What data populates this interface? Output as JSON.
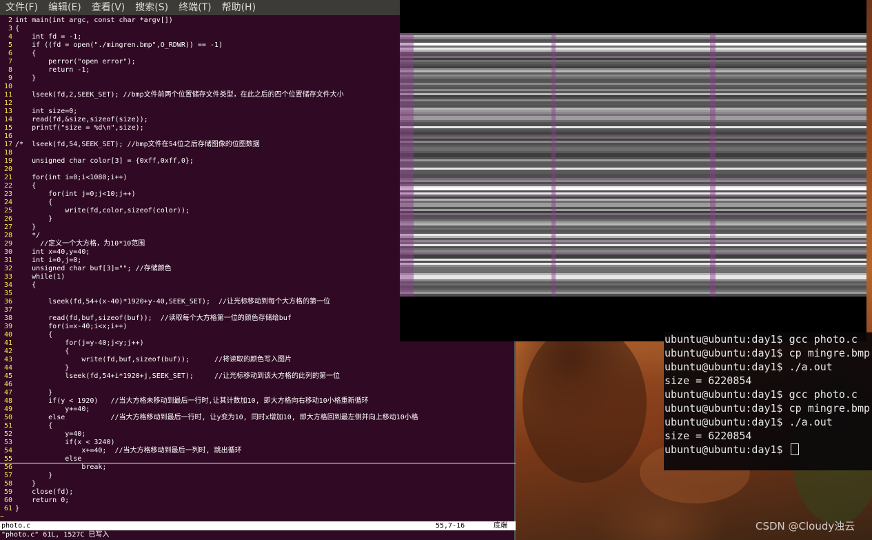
{
  "menubar": {
    "items": [
      "文件(F)",
      "编辑(E)",
      "查看(V)",
      "搜索(S)",
      "终端(T)",
      "帮助(H)"
    ]
  },
  "editor": {
    "lines": [
      {
        "n": "2",
        "t": "int main(int argc, const char *argv[])"
      },
      {
        "n": "3",
        "t": "{"
      },
      {
        "n": "4",
        "t": "    int fd = -1;"
      },
      {
        "n": "5",
        "t": "    if ((fd = open(\"./mingren.bmp\",O_RDWR)) == -1)"
      },
      {
        "n": "6",
        "t": "    {"
      },
      {
        "n": "7",
        "t": "        perror(\"open error\");"
      },
      {
        "n": "8",
        "t": "        return -1;"
      },
      {
        "n": "9",
        "t": "    }"
      },
      {
        "n": "10",
        "t": ""
      },
      {
        "n": "11",
        "t": "    lseek(fd,2,SEEK_SET); //bmp文件前两个位置储存文件类型，在此之后的四个位置储存文件大小"
      },
      {
        "n": "12",
        "t": ""
      },
      {
        "n": "13",
        "t": "    int size=0;"
      },
      {
        "n": "14",
        "t": "    read(fd,&size,sizeof(size));"
      },
      {
        "n": "15",
        "t": "    printf(\"size = %d\\n\",size);"
      },
      {
        "n": "16",
        "t": ""
      },
      {
        "n": "17",
        "t": "/*  lseek(fd,54,SEEK_SET); //bmp文件在54位之后存储图像的位图数据"
      },
      {
        "n": "18",
        "t": ""
      },
      {
        "n": "19",
        "t": "    unsigned char color[3] = {0xff,0xff,0};"
      },
      {
        "n": "20",
        "t": ""
      },
      {
        "n": "21",
        "t": "    for(int i=0;i<1080;i++)"
      },
      {
        "n": "22",
        "t": "    {"
      },
      {
        "n": "23",
        "t": "        for(int j=0;j<10;j++)"
      },
      {
        "n": "24",
        "t": "        {"
      },
      {
        "n": "25",
        "t": "            write(fd,color,sizeof(color));"
      },
      {
        "n": "26",
        "t": "        }"
      },
      {
        "n": "27",
        "t": "    }"
      },
      {
        "n": "28",
        "t": "    */"
      },
      {
        "n": "29",
        "t": "      //定义一个大方格，为10*10范围"
      },
      {
        "n": "30",
        "t": "    int x=40,y=40;"
      },
      {
        "n": "31",
        "t": "    int i=0,j=0;"
      },
      {
        "n": "32",
        "t": "    unsigned char buf[3]=\"\"; //存储颜色"
      },
      {
        "n": "33",
        "t": "    while(1)"
      },
      {
        "n": "34",
        "t": "    {"
      },
      {
        "n": "35",
        "t": ""
      },
      {
        "n": "36",
        "t": "        lseek(fd,54+(x-40)*1920+y-40,SEEK_SET);  //让光标移动到每个大方格的第一位"
      },
      {
        "n": "37",
        "t": ""
      },
      {
        "n": "38",
        "t": "        read(fd,buf,sizeof(buf));  //读取每个大方格第一位的颜色存储给buf"
      },
      {
        "n": "39",
        "t": "        for(i=x-40;i<x;i++)"
      },
      {
        "n": "40",
        "t": "        {"
      },
      {
        "n": "41",
        "t": "            for(j=y-40;j<y;j++)"
      },
      {
        "n": "42",
        "t": "            {"
      },
      {
        "n": "43",
        "t": "                write(fd,buf,sizeof(buf));      //将读取的颜色写入图片"
      },
      {
        "n": "44",
        "t": "            }"
      },
      {
        "n": "45",
        "t": "            lseek(fd,54+i*1920+j,SEEK_SET);     //让光标移动到该大方格的此列的第一位"
      },
      {
        "n": "46",
        "t": ""
      },
      {
        "n": "47",
        "t": "        }"
      },
      {
        "n": "48",
        "t": "        if(y < 1920)   //当大方格未移动到最后一行时,让其计数加10, 即大方格向右移动10小格重新循环"
      },
      {
        "n": "49",
        "t": "            y+=40;"
      },
      {
        "n": "50",
        "t": "        else           //当大方格移动到最后一行时, 让y变为10, 同时x增加10, 即大方格回到最左侧并向上移动10小格"
      },
      {
        "n": "51",
        "t": "        {"
      },
      {
        "n": "52",
        "t": "            y=40;"
      },
      {
        "n": "53",
        "t": "            if(x < 3240)"
      },
      {
        "n": "54",
        "t": "                x+=40;  //当大方格移动到最后一列时, 跳出循环"
      },
      {
        "n": "55",
        "t": "            else"
      },
      {
        "n": "56",
        "t": "                break;"
      },
      {
        "n": "57",
        "t": "        }"
      },
      {
        "n": "58",
        "t": "    }"
      },
      {
        "n": "59",
        "t": "    close(fd);"
      },
      {
        "n": "60",
        "t": "    return 0;"
      },
      {
        "n": "61",
        "t": "}"
      }
    ],
    "filler_lines": [
      "~"
    ]
  },
  "statusline": {
    "filename": "photo.c",
    "position": "55,7-16",
    "scroll": "底端"
  },
  "message": "\"photo.c\" 61L, 1527C 已写入",
  "terminal": {
    "lines": [
      "ubuntu@ubuntu:day1$ gcc photo.c",
      "ubuntu@ubuntu:day1$ cp mingre.bmp",
      "ubuntu@ubuntu:day1$ ./a.out",
      "size = 6220854",
      "ubuntu@ubuntu:day1$ gcc photo.c",
      "ubuntu@ubuntu:day1$ cp mingre.bmp",
      "ubuntu@ubuntu:day1$ ./a.out",
      "size = 6220854"
    ],
    "prompt": "ubuntu@ubuntu:day1$ "
  },
  "watermark": "CSDN @Cloudy浊云",
  "colors": {
    "terminal_bg": "#300a24",
    "line_number": "#fce94f",
    "menubar_bg": "#3c3b37"
  }
}
